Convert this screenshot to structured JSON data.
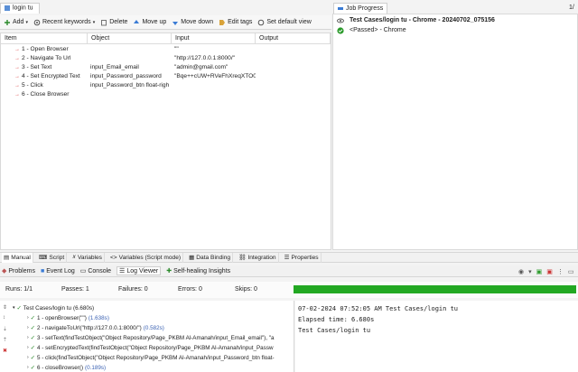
{
  "editor": {
    "tab_label": "login tu"
  },
  "toolbar": {
    "add": "Add",
    "recent_keywords": "Recent keywords",
    "delete": "Delete",
    "move_up": "Move up",
    "move_down": "Move down",
    "edit_tags": "Edit tags",
    "set_default_view": "Set default view"
  },
  "steps": {
    "columns": [
      "Item",
      "Object",
      "Input",
      "Output"
    ],
    "rows": [
      {
        "item": "1 - Open Browser",
        "object": "",
        "input": "\"\"",
        "output": ""
      },
      {
        "item": "2 - Navigate To Url",
        "object": "",
        "input": "\"http://127.0.0.1:8000/\"",
        "output": ""
      },
      {
        "item": "3 - Set Text",
        "object": "input_Email_email",
        "input": "\"admin@gmail.com\"",
        "output": ""
      },
      {
        "item": "4 - Set Encrypted Text",
        "object": "input_Password_password",
        "input": "\"Bqe++cUW+RVeFhXreqXTO0",
        "output": ""
      },
      {
        "item": "5 - Click",
        "object": "input_Password_btn float-righ",
        "input": "",
        "output": ""
      },
      {
        "item": "6 - Close Browser",
        "object": "",
        "input": "",
        "output": ""
      }
    ]
  },
  "job_progress": {
    "tab_label": "Job Progress",
    "count": "1/",
    "job_title": "Test Cases/login tu - Chrome - 20240702_075156",
    "job_status": "<Passed> - Chrome"
  },
  "bottom_tabs": [
    "Manual",
    "Script",
    "Variables",
    "Variables (Script mode)",
    "Data Binding",
    "Integration",
    "Properties"
  ],
  "console_tabs": [
    "Problems",
    "Event Log",
    "Console",
    "Log Viewer",
    "Self-healing Insights"
  ],
  "stats": {
    "runs": "Runs: 1/1",
    "passes": "Passes: 1",
    "failures": "Failures: 0",
    "errors": "Errors: 0",
    "skips": "Skips: 0",
    "progress": 1.0
  },
  "log_tree": {
    "root": "Test Cases/login tu",
    "root_time": "(6.680s)",
    "items": [
      {
        "label": "1 - openBrowser(\"\")",
        "time": "(1.638s)"
      },
      {
        "label": "2 - navigateToUrl(\"http://127.0.0.1:8000/\")",
        "time": "(0.582s)"
      },
      {
        "label": "3 - setText(findTestObject(\"Object Repository/Page_PKBM Al-Amanah/input_Email_email\"), \"a",
        "time": ""
      },
      {
        "label": "4 - setEncryptedText(findTestObject(\"Object Repository/Page_PKBM Al-Amanah/input_Passw",
        "time": ""
      },
      {
        "label": "5 - click(findTestObject(\"Object Repository/Page_PKBM Al-Amanah/input_Password_btn float-",
        "time": ""
      },
      {
        "label": "6 - closeBrowser()",
        "time": "(0.189s)"
      }
    ]
  },
  "log_text": {
    "line1": "07-02-2024 07:52:05 AM Test Cases/login tu",
    "line2": "Elapsed time: 6.680s",
    "line3": "Test Cases/login tu"
  },
  "colors": {
    "pass": "#22a822",
    "fail_arrow": "#dd4444",
    "time_link": "#3b62b3"
  }
}
